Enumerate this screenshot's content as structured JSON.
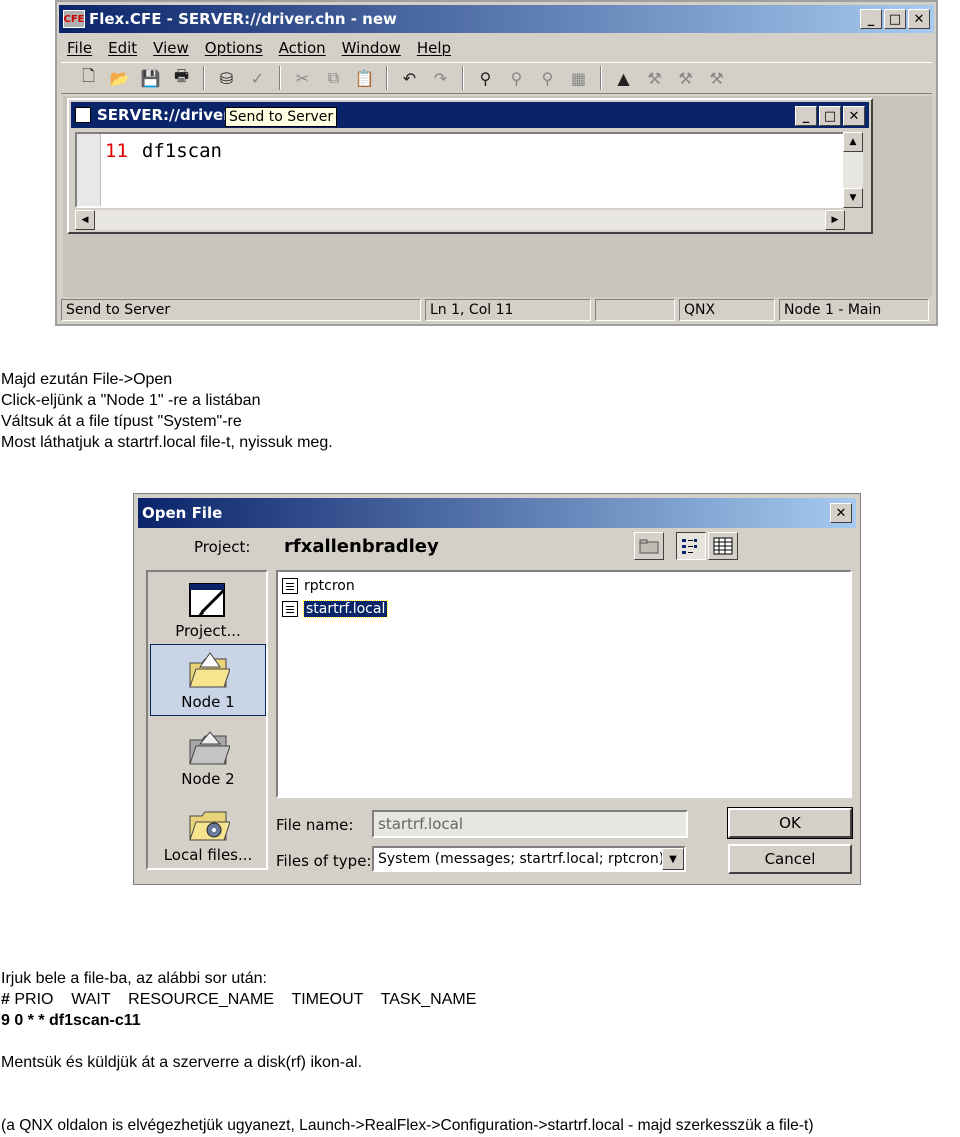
{
  "cfe_window": {
    "title": "Flex.CFE - SERVER://driver.chn - new",
    "logo_text": "CFE",
    "menu": [
      "File",
      "Edit",
      "View",
      "Options",
      "Action",
      "Window",
      "Help"
    ],
    "child": {
      "title": "SERVER://driver",
      "tooltip": "Send to Server",
      "code_line_number": "11",
      "code_text": "df1scan"
    },
    "statusbar": {
      "message": "Send to Server",
      "position": "Ln 1, Col 11",
      "os": "QNX",
      "node": "Node 1 - Main"
    }
  },
  "intro_lines": [
    "Majd ezután File->Open",
    "Click-eljünk a \"Node 1\" -re a listában",
    "Váltsuk át a file típust \"System\"-re",
    "Most láthatjuk a startrf.local file-t, nyissuk meg."
  ],
  "open_file_dialog": {
    "title": "Open File",
    "project_label": "Project:",
    "project_name": "rfxallenbradley",
    "places": [
      {
        "label": "Project...",
        "icon": "project-icon",
        "selected": false
      },
      {
        "label": "Node 1",
        "icon": "open-folder-icon",
        "selected": true
      },
      {
        "label": "Node 2",
        "icon": "folder-icon",
        "selected": false
      },
      {
        "label": "Local files...",
        "icon": "local-folder-icon",
        "selected": false
      }
    ],
    "files": [
      {
        "name": "rptcron",
        "selected": false
      },
      {
        "name": "startrf.local",
        "selected": true
      }
    ],
    "file_name_label": "File name:",
    "file_name_value": "startrf.local",
    "file_type_label": "Files of type:",
    "file_type_value": "System (messages; startrf.local; rptcron)",
    "ok_label": "OK",
    "cancel_label": "Cancel"
  },
  "instructions": {
    "line1": "Irjuk bele a file-ba, az alábbi sor után:",
    "header_hash": "#",
    "header_rest": " PRIO    WAIT    RESOURCE_NAME    TIMEOUT    TASK_NAME",
    "entry": "9 0 * * df1scan-c11",
    "save_line": "Mentsük és küldjük át a szerverre a disk(rf) ikon-al.",
    "note": "(a QNX oldalon is elvégezhetjük ugyanezt, Launch->RealFlex->Configuration->startrf.local - majd szerkesszük a file-t)"
  }
}
